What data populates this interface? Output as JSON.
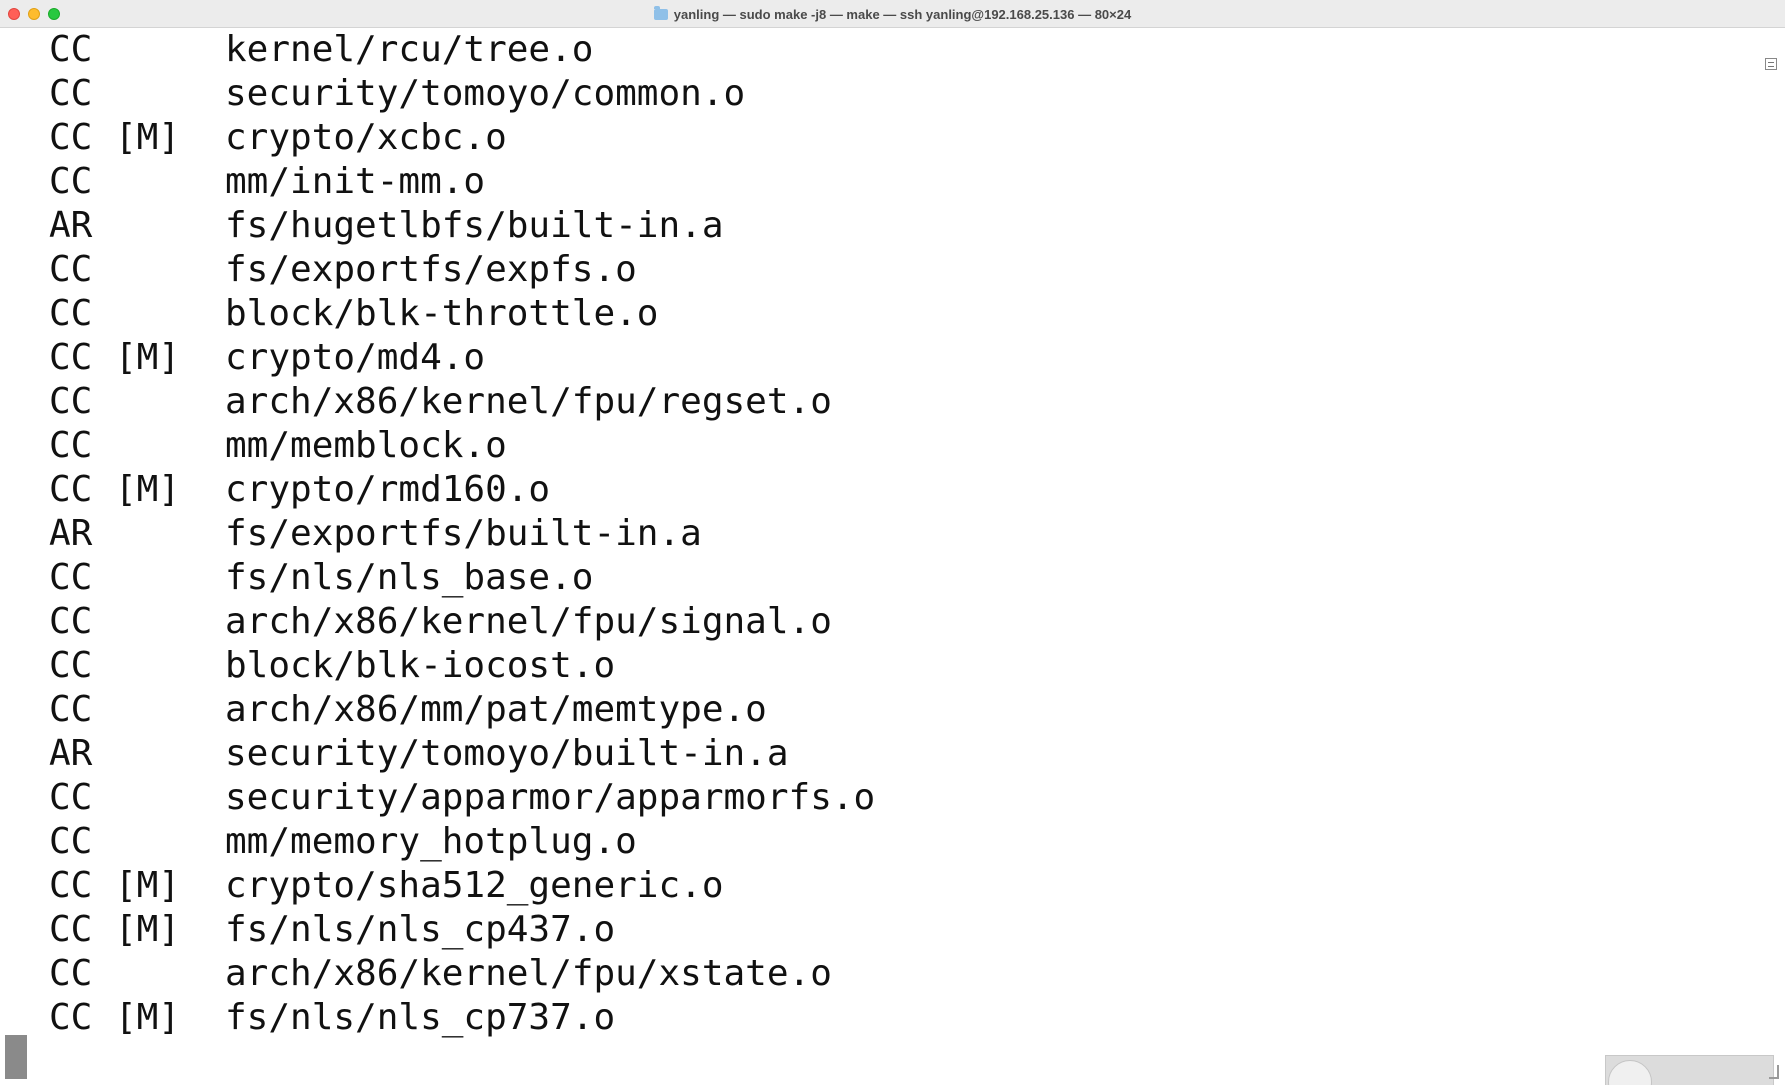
{
  "window": {
    "title": "yanling — sudo make -j8 — make — ssh yanling@192.168.25.136 — 80×24",
    "icon": "folder-icon",
    "colors": {
      "background": "#ffffff",
      "text": "#111111",
      "titlebar": "#ececec"
    }
  },
  "terminal": {
    "lines": [
      {
        "op": "CC",
        "mod": "",
        "path": "kernel/rcu/tree.o"
      },
      {
        "op": "CC",
        "mod": "",
        "path": "security/tomoyo/common.o"
      },
      {
        "op": "CC",
        "mod": "[M]",
        "path": "crypto/xcbc.o"
      },
      {
        "op": "CC",
        "mod": "",
        "path": "mm/init-mm.o"
      },
      {
        "op": "AR",
        "mod": "",
        "path": "fs/hugetlbfs/built-in.a"
      },
      {
        "op": "CC",
        "mod": "",
        "path": "fs/exportfs/expfs.o"
      },
      {
        "op": "CC",
        "mod": "",
        "path": "block/blk-throttle.o"
      },
      {
        "op": "CC",
        "mod": "[M]",
        "path": "crypto/md4.o"
      },
      {
        "op": "CC",
        "mod": "",
        "path": "arch/x86/kernel/fpu/regset.o"
      },
      {
        "op": "CC",
        "mod": "",
        "path": "mm/memblock.o"
      },
      {
        "op": "CC",
        "mod": "[M]",
        "path": "crypto/rmd160.o"
      },
      {
        "op": "AR",
        "mod": "",
        "path": "fs/exportfs/built-in.a"
      },
      {
        "op": "CC",
        "mod": "",
        "path": "fs/nls/nls_base.o"
      },
      {
        "op": "CC",
        "mod": "",
        "path": "arch/x86/kernel/fpu/signal.o"
      },
      {
        "op": "CC",
        "mod": "",
        "path": "block/blk-iocost.o"
      },
      {
        "op": "CC",
        "mod": "",
        "path": "arch/x86/mm/pat/memtype.o"
      },
      {
        "op": "AR",
        "mod": "",
        "path": "security/tomoyo/built-in.a"
      },
      {
        "op": "CC",
        "mod": "",
        "path": "security/apparmor/apparmorfs.o"
      },
      {
        "op": "CC",
        "mod": "",
        "path": "mm/memory_hotplug.o"
      },
      {
        "op": "CC",
        "mod": "[M]",
        "path": "crypto/sha512_generic.o"
      },
      {
        "op": "CC",
        "mod": "[M]",
        "path": "fs/nls/nls_cp437.o"
      },
      {
        "op": "CC",
        "mod": "",
        "path": "arch/x86/kernel/fpu/xstate.o"
      },
      {
        "op": "CC",
        "mod": "[M]",
        "path": "fs/nls/nls_cp737.o"
      }
    ]
  }
}
